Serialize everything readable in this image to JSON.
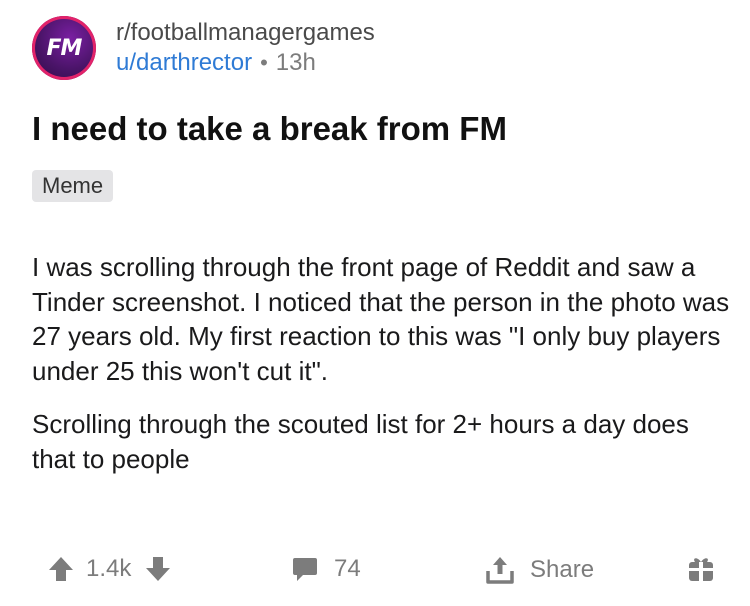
{
  "post": {
    "avatar_text": "FM",
    "subreddit": "r/footballmanagergames",
    "username": "u/darthrector",
    "separator": "•",
    "time": "13h",
    "title": "I need to take a break from FM",
    "flair": "Meme",
    "paragraphs": [
      "I was scrolling through the front page of Reddit and saw a Tinder screenshot. I noticed that the person in the photo was 27 years old. My first reaction to this was \"I only buy players under 25 this won't cut it\".",
      "Scrolling through the scouted list for 2+ hours a day does that to people"
    ]
  },
  "actions": {
    "upvote_icon": "arrow-up-icon",
    "vote_count": "1.4k",
    "downvote_icon": "arrow-down-icon",
    "comment_icon": "comment-bubble-icon",
    "comment_count": "74",
    "share_icon": "share-icon",
    "share_label": "Share",
    "award_icon": "gift-icon"
  },
  "colors": {
    "username": "#2f7bd5",
    "muted": "#7c7c7c",
    "flair_bg": "#e4e4e6",
    "avatar_bg": "#4a1468",
    "avatar_ring": "#e2236a"
  }
}
